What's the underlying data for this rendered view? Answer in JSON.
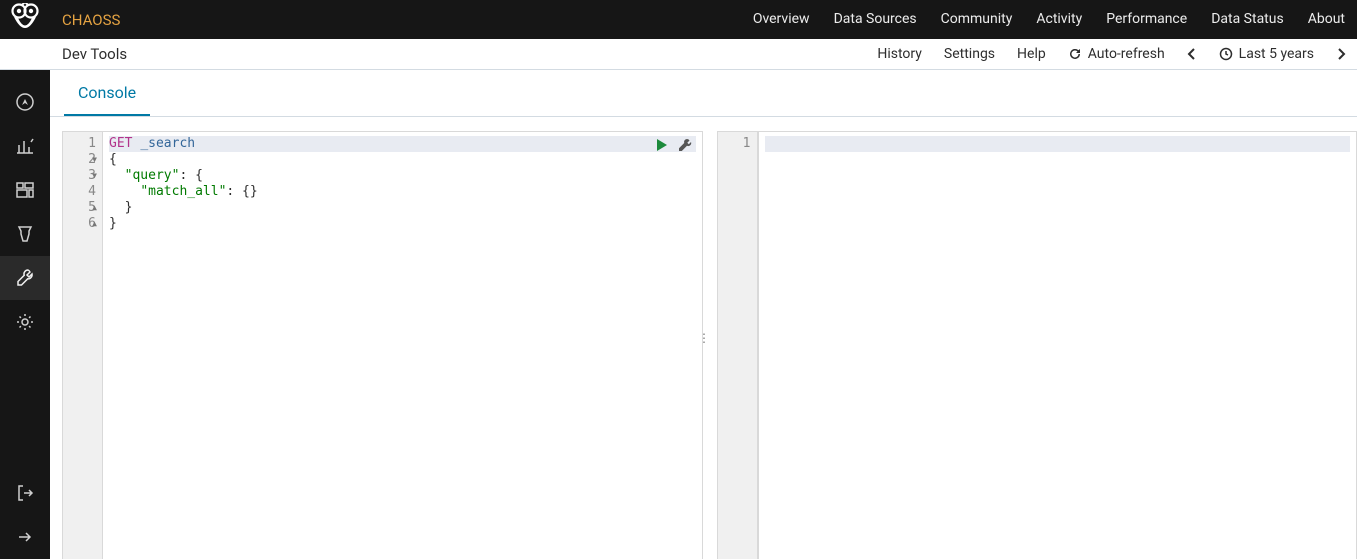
{
  "brand": "CHAOSS",
  "topnav": [
    "Overview",
    "Data Sources",
    "Community",
    "Activity",
    "Performance",
    "Data Status",
    "About"
  ],
  "breadcrumb": "Dev Tools",
  "subnav": {
    "history": "History",
    "settings": "Settings",
    "help": "Help",
    "autorefresh": "Auto-refresh",
    "timerange": "Last 5 years"
  },
  "tab": "Console",
  "editor_left": {
    "lines": [
      {
        "n": "1",
        "method": "GET",
        "endpoint": "_search",
        "hl": true
      },
      {
        "n": "2",
        "text": "{",
        "fold": "down"
      },
      {
        "n": "3",
        "indent": "  ",
        "key": "\"query\"",
        "after": ": {",
        "fold": "down"
      },
      {
        "n": "4",
        "indent": "    ",
        "key": "\"match_all\"",
        "after": ": {}"
      },
      {
        "n": "5",
        "text": "  }",
        "fold": "up"
      },
      {
        "n": "6",
        "text": "}",
        "fold": "up"
      }
    ]
  },
  "editor_right": {
    "lines": [
      {
        "n": "1",
        "text": "",
        "hl": true
      }
    ]
  }
}
